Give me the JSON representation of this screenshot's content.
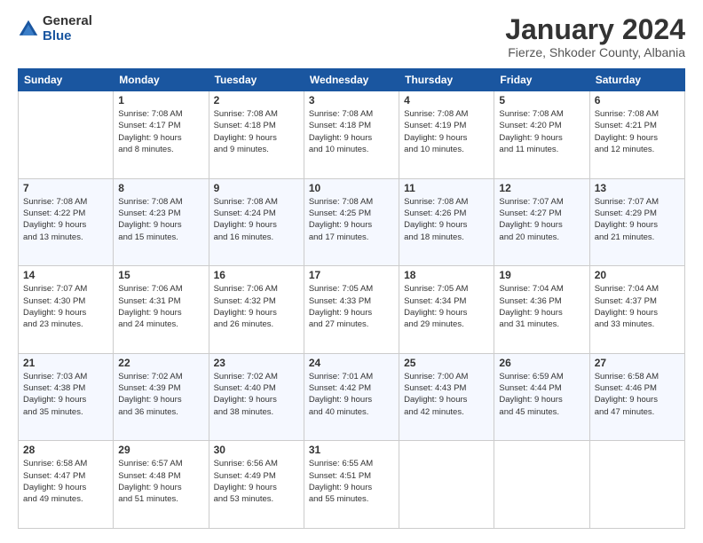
{
  "logo": {
    "general": "General",
    "blue": "Blue"
  },
  "title": "January 2024",
  "location": "Fierze, Shkoder County, Albania",
  "days_of_week": [
    "Sunday",
    "Monday",
    "Tuesday",
    "Wednesday",
    "Thursday",
    "Friday",
    "Saturday"
  ],
  "weeks": [
    [
      {
        "day": "",
        "info": ""
      },
      {
        "day": "1",
        "info": "Sunrise: 7:08 AM\nSunset: 4:17 PM\nDaylight: 9 hours\nand 8 minutes."
      },
      {
        "day": "2",
        "info": "Sunrise: 7:08 AM\nSunset: 4:18 PM\nDaylight: 9 hours\nand 9 minutes."
      },
      {
        "day": "3",
        "info": "Sunrise: 7:08 AM\nSunset: 4:18 PM\nDaylight: 9 hours\nand 10 minutes."
      },
      {
        "day": "4",
        "info": "Sunrise: 7:08 AM\nSunset: 4:19 PM\nDaylight: 9 hours\nand 10 minutes."
      },
      {
        "day": "5",
        "info": "Sunrise: 7:08 AM\nSunset: 4:20 PM\nDaylight: 9 hours\nand 11 minutes."
      },
      {
        "day": "6",
        "info": "Sunrise: 7:08 AM\nSunset: 4:21 PM\nDaylight: 9 hours\nand 12 minutes."
      }
    ],
    [
      {
        "day": "7",
        "info": "Sunrise: 7:08 AM\nSunset: 4:22 PM\nDaylight: 9 hours\nand 13 minutes."
      },
      {
        "day": "8",
        "info": "Sunrise: 7:08 AM\nSunset: 4:23 PM\nDaylight: 9 hours\nand 15 minutes."
      },
      {
        "day": "9",
        "info": "Sunrise: 7:08 AM\nSunset: 4:24 PM\nDaylight: 9 hours\nand 16 minutes."
      },
      {
        "day": "10",
        "info": "Sunrise: 7:08 AM\nSunset: 4:25 PM\nDaylight: 9 hours\nand 17 minutes."
      },
      {
        "day": "11",
        "info": "Sunrise: 7:08 AM\nSunset: 4:26 PM\nDaylight: 9 hours\nand 18 minutes."
      },
      {
        "day": "12",
        "info": "Sunrise: 7:07 AM\nSunset: 4:27 PM\nDaylight: 9 hours\nand 20 minutes."
      },
      {
        "day": "13",
        "info": "Sunrise: 7:07 AM\nSunset: 4:29 PM\nDaylight: 9 hours\nand 21 minutes."
      }
    ],
    [
      {
        "day": "14",
        "info": "Sunrise: 7:07 AM\nSunset: 4:30 PM\nDaylight: 9 hours\nand 23 minutes."
      },
      {
        "day": "15",
        "info": "Sunrise: 7:06 AM\nSunset: 4:31 PM\nDaylight: 9 hours\nand 24 minutes."
      },
      {
        "day": "16",
        "info": "Sunrise: 7:06 AM\nSunset: 4:32 PM\nDaylight: 9 hours\nand 26 minutes."
      },
      {
        "day": "17",
        "info": "Sunrise: 7:05 AM\nSunset: 4:33 PM\nDaylight: 9 hours\nand 27 minutes."
      },
      {
        "day": "18",
        "info": "Sunrise: 7:05 AM\nSunset: 4:34 PM\nDaylight: 9 hours\nand 29 minutes."
      },
      {
        "day": "19",
        "info": "Sunrise: 7:04 AM\nSunset: 4:36 PM\nDaylight: 9 hours\nand 31 minutes."
      },
      {
        "day": "20",
        "info": "Sunrise: 7:04 AM\nSunset: 4:37 PM\nDaylight: 9 hours\nand 33 minutes."
      }
    ],
    [
      {
        "day": "21",
        "info": "Sunrise: 7:03 AM\nSunset: 4:38 PM\nDaylight: 9 hours\nand 35 minutes."
      },
      {
        "day": "22",
        "info": "Sunrise: 7:02 AM\nSunset: 4:39 PM\nDaylight: 9 hours\nand 36 minutes."
      },
      {
        "day": "23",
        "info": "Sunrise: 7:02 AM\nSunset: 4:40 PM\nDaylight: 9 hours\nand 38 minutes."
      },
      {
        "day": "24",
        "info": "Sunrise: 7:01 AM\nSunset: 4:42 PM\nDaylight: 9 hours\nand 40 minutes."
      },
      {
        "day": "25",
        "info": "Sunrise: 7:00 AM\nSunset: 4:43 PM\nDaylight: 9 hours\nand 42 minutes."
      },
      {
        "day": "26",
        "info": "Sunrise: 6:59 AM\nSunset: 4:44 PM\nDaylight: 9 hours\nand 45 minutes."
      },
      {
        "day": "27",
        "info": "Sunrise: 6:58 AM\nSunset: 4:46 PM\nDaylight: 9 hours\nand 47 minutes."
      }
    ],
    [
      {
        "day": "28",
        "info": "Sunrise: 6:58 AM\nSunset: 4:47 PM\nDaylight: 9 hours\nand 49 minutes."
      },
      {
        "day": "29",
        "info": "Sunrise: 6:57 AM\nSunset: 4:48 PM\nDaylight: 9 hours\nand 51 minutes."
      },
      {
        "day": "30",
        "info": "Sunrise: 6:56 AM\nSunset: 4:49 PM\nDaylight: 9 hours\nand 53 minutes."
      },
      {
        "day": "31",
        "info": "Sunrise: 6:55 AM\nSunset: 4:51 PM\nDaylight: 9 hours\nand 55 minutes."
      },
      {
        "day": "",
        "info": ""
      },
      {
        "day": "",
        "info": ""
      },
      {
        "day": "",
        "info": ""
      }
    ]
  ]
}
